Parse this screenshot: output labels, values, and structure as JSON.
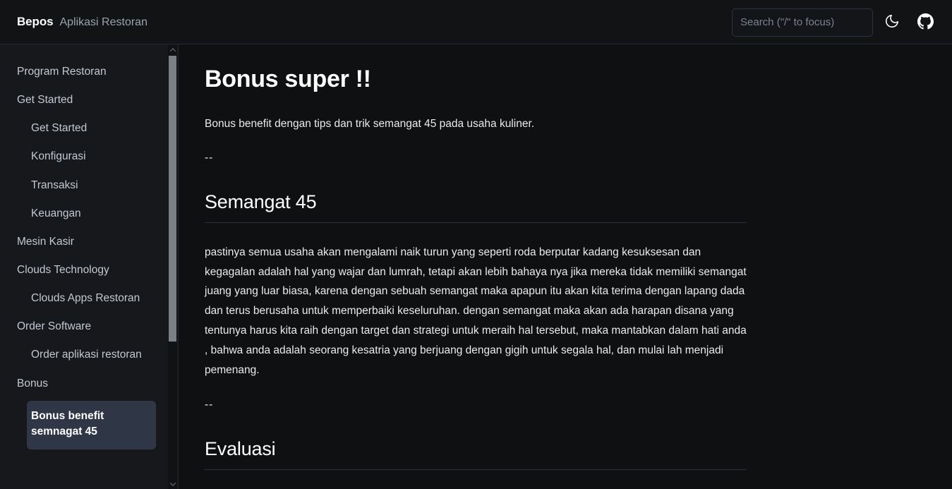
{
  "header": {
    "brand_name": "Bepos",
    "brand_subtitle": "Aplikasi Restoran",
    "search_placeholder": "Search (\"/\" to focus)",
    "search_value": "",
    "theme_toggle_icon": "moon-icon",
    "github_icon": "github-icon"
  },
  "sidebar": {
    "items": [
      {
        "label": "Program Restoran",
        "level": 1,
        "active": false
      },
      {
        "label": "Get Started",
        "level": 1,
        "active": false
      },
      {
        "label": "Get Started",
        "level": 2,
        "active": false
      },
      {
        "label": "Konfigurasi",
        "level": 2,
        "active": false
      },
      {
        "label": "Transaksi",
        "level": 2,
        "active": false
      },
      {
        "label": "Keuangan",
        "level": 2,
        "active": false
      },
      {
        "label": "Mesin Kasir",
        "level": 1,
        "active": false
      },
      {
        "label": "Clouds Technology",
        "level": 1,
        "active": false
      },
      {
        "label": "Clouds Apps Restoran",
        "level": 2,
        "active": false
      },
      {
        "label": "Order Software",
        "level": 1,
        "active": false
      },
      {
        "label": "Order aplikasi restoran",
        "level": 2,
        "active": false
      },
      {
        "label": "Bonus",
        "level": 1,
        "active": false
      },
      {
        "label": "Bonus benefit semnagat 45",
        "level": 2,
        "active": true
      }
    ],
    "scroll_up_icon": "chevron-up-icon",
    "scroll_down_icon": "chevron-down-icon"
  },
  "main": {
    "title": "Bonus super !!",
    "intro": "Bonus benefit dengan tips dan trik semangat 45 pada usaha kuliner.",
    "separator_1": "--",
    "section_1_heading": "Semangat 45",
    "section_1_body": "pastinya semua usaha akan mengalami naik turun yang seperti roda berputar kadang kesuksesan dan kegagalan adalah hal yang wajar dan lumrah, tetapi akan lebih bahaya nya jika mereka tidak memiliki semangat juang yang luar biasa, karena dengan sebuah semangat maka apapun itu akan kita terima dengan lapang dada dan terus berusaha untuk memperbaiki keseluruhan. dengan semangat maka akan ada harapan disana yang tentunya harus kita raih dengan target dan strategi untuk meraih hal tersebut, maka mantabkan dalam hati anda , bahwa anda adalah seorang kesatria yang berjuang dengan gigih untuk segala hal, dan mulai lah menjadi pemenang.",
    "separator_2": "--",
    "section_2_heading": "Evaluasi"
  },
  "colors": {
    "page_background": "#0f1011",
    "sidebar_background": "#16181c",
    "header_background": "#121315",
    "active_item_background": "#2f3747",
    "text_primary": "#ffffff",
    "text_secondary": "#c3c9d1",
    "border": "#2b3140"
  }
}
